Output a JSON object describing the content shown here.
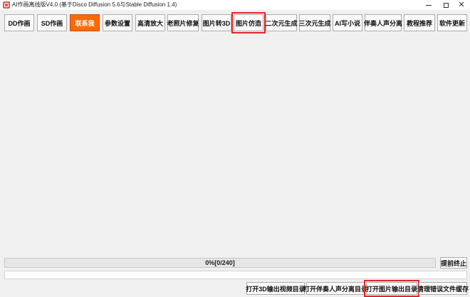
{
  "window": {
    "title": "AI作画离线版V4.0 (基于Disco Diffusion 5.6与Stable Diffusion 1.4)",
    "icon": "app-icon"
  },
  "toolbar": {
    "buttons": [
      {
        "label": "DD作画",
        "name": "tab-dd-drawing"
      },
      {
        "label": "SD作画",
        "name": "tab-sd-drawing"
      },
      {
        "label": "联系我",
        "name": "tab-contact-me",
        "active": true
      },
      {
        "label": "参数设置",
        "name": "tab-parameter-settings"
      },
      {
        "label": "高清放大",
        "name": "tab-hd-upscale"
      },
      {
        "label": "老照片修复",
        "name": "tab-old-photo-repair"
      },
      {
        "label": "图片转3D",
        "name": "tab-image-to-3d"
      },
      {
        "label": "图片仿造",
        "name": "tab-image-imitation",
        "highlight": true
      },
      {
        "label": "二次元生成",
        "name": "tab-2d-anime-generate"
      },
      {
        "label": "三次元生成",
        "name": "tab-3d-realistic-generate"
      },
      {
        "label": "AI写小说",
        "name": "tab-ai-write-novel"
      },
      {
        "label": "伴奏人声分离",
        "name": "tab-vocal-separation"
      },
      {
        "label": "教程推荐",
        "name": "tab-tutorial-recommend"
      },
      {
        "label": "软件更新",
        "name": "tab-software-update"
      }
    ],
    "active_color": "#ff6a00"
  },
  "progress": {
    "text": "0%[0/240]",
    "value": 0,
    "stop_label": "提前终止"
  },
  "bottom_buttons": [
    {
      "label": "打开3D输出视频目录",
      "name": "open-3d-video-dir-button"
    },
    {
      "label": "打开伴奏人声分离目录",
      "name": "open-vocal-separation-dir-button"
    },
    {
      "label": "打开图片输出目录",
      "name": "open-image-output-dir-button",
      "highlight": true
    },
    {
      "label": "清理错误文件缓存",
      "name": "clear-error-cache-button"
    }
  ],
  "highlight_color": "#e0262c"
}
